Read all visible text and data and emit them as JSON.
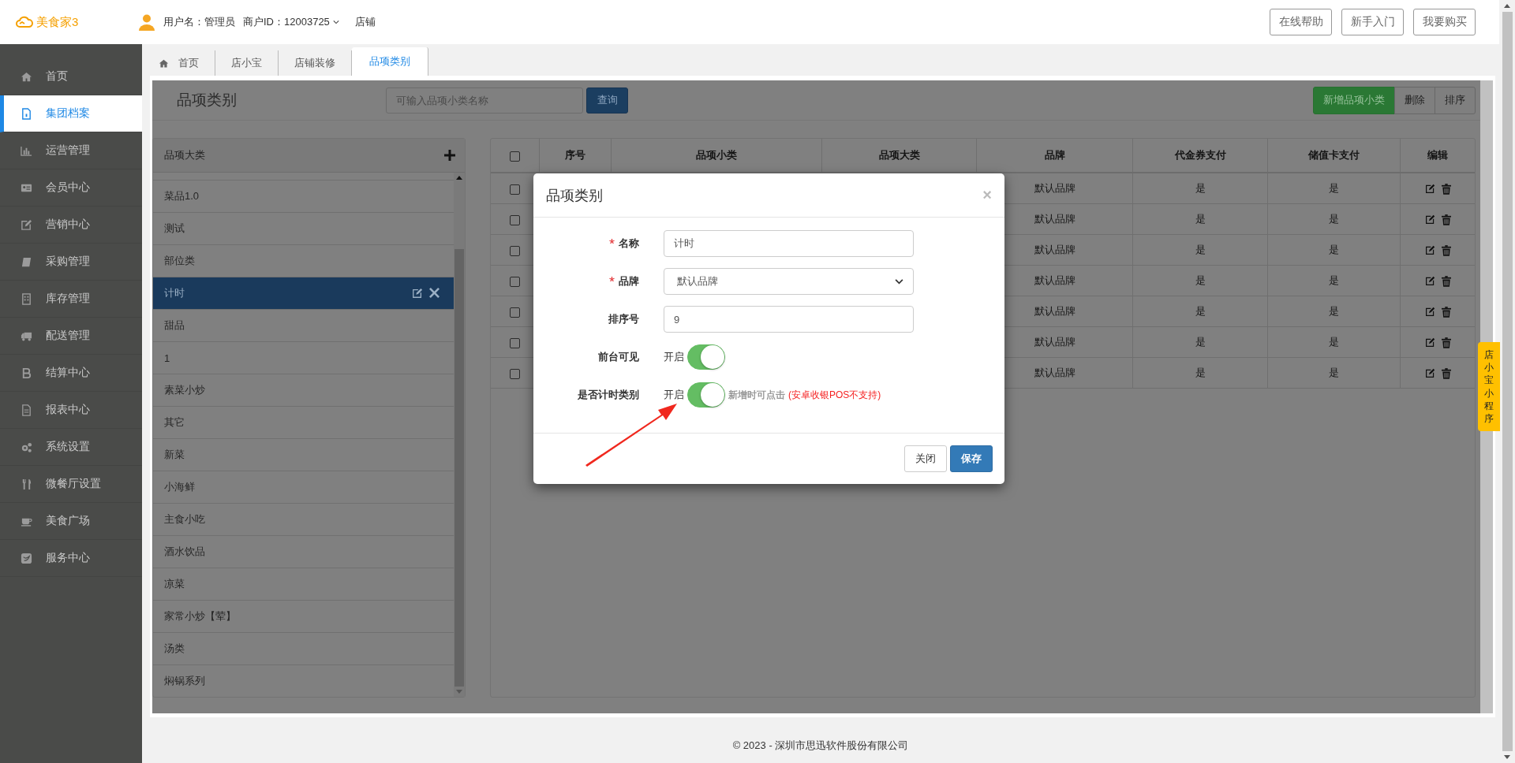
{
  "header": {
    "logo": "美食家3",
    "user": "用户名：管理员",
    "merchant": "商户ID：12003725",
    "store": "店铺",
    "buttons": [
      "在线帮助",
      "新手入门",
      "我要购买"
    ]
  },
  "sidebar": {
    "items": [
      {
        "label": "首页",
        "selected": false
      },
      {
        "label": "集团档案",
        "selected": true
      },
      {
        "label": "运营管理",
        "selected": false
      },
      {
        "label": "会员中心",
        "selected": false
      },
      {
        "label": "营销中心",
        "selected": false
      },
      {
        "label": "采购管理",
        "selected": false
      },
      {
        "label": "库存管理",
        "selected": false
      },
      {
        "label": "配送管理",
        "selected": false
      },
      {
        "label": "结算中心",
        "selected": false
      },
      {
        "label": "报表中心",
        "selected": false
      },
      {
        "label": "系统设置",
        "selected": false
      },
      {
        "label": "微餐厅设置",
        "selected": false
      },
      {
        "label": "美食广场",
        "selected": false
      },
      {
        "label": "服务中心",
        "selected": false
      }
    ]
  },
  "tabs": [
    {
      "label": "首页",
      "selected": false
    },
    {
      "label": "店小宝",
      "selected": false
    },
    {
      "label": "店铺装修",
      "selected": false
    },
    {
      "label": "品项类别",
      "selected": true
    }
  ],
  "page": {
    "title": "品项类别",
    "search": {
      "placeholder": "可输入品项小类名称"
    },
    "search_button": "查询",
    "actions": [
      {
        "label": "新增品项小类",
        "kind": "primary"
      },
      {
        "label": "删除",
        "kind": "default"
      },
      {
        "label": "排序",
        "kind": "default"
      }
    ]
  },
  "category_panel": {
    "title": "品项大类",
    "items": [
      {
        "label": "菜品1.0",
        "selected": false
      },
      {
        "label": "测试",
        "selected": false
      },
      {
        "label": "部位类",
        "selected": false
      },
      {
        "label": "计时",
        "selected": true
      },
      {
        "label": "甜品",
        "selected": false
      },
      {
        "label": "1",
        "selected": false
      },
      {
        "label": "素菜小炒",
        "selected": false
      },
      {
        "label": "其它",
        "selected": false
      },
      {
        "label": "新菜",
        "selected": false
      },
      {
        "label": "小海鲜",
        "selected": false
      },
      {
        "label": "主食小吃",
        "selected": false
      },
      {
        "label": "酒水饮品",
        "selected": false
      },
      {
        "label": "凉菜",
        "selected": false
      },
      {
        "label": "家常小炒【荤】",
        "selected": false
      },
      {
        "label": "汤类",
        "selected": false
      },
      {
        "label": "焖锅系列",
        "selected": false
      }
    ]
  },
  "table": {
    "select_all_checked": false,
    "columns": [
      "序号",
      "品项小类",
      "品项大类",
      "品牌",
      "代金券支付",
      "储值卡支付",
      "编辑"
    ],
    "rows": [
      {
        "checked": false,
        "brand": "默认品牌",
        "voucher_pay": "是",
        "stored_value_pay": "是"
      },
      {
        "checked": false,
        "brand": "默认品牌",
        "voucher_pay": "是",
        "stored_value_pay": "是"
      },
      {
        "checked": false,
        "brand": "默认品牌",
        "voucher_pay": "是",
        "stored_value_pay": "是"
      },
      {
        "checked": false,
        "brand": "默认品牌",
        "voucher_pay": "是",
        "stored_value_pay": "是"
      },
      {
        "checked": false,
        "brand": "默认品牌",
        "voucher_pay": "是",
        "stored_value_pay": "是"
      },
      {
        "checked": false,
        "brand": "默认品牌",
        "voucher_pay": "是",
        "stored_value_pay": "是"
      },
      {
        "checked": false,
        "brand": "默认品牌",
        "voucher_pay": "是",
        "stored_value_pay": "是"
      }
    ]
  },
  "modal": {
    "title": "品项类别",
    "close": "×",
    "fields": [
      {
        "kind": "text",
        "label": "名称",
        "required": true,
        "value": "计时"
      },
      {
        "kind": "select",
        "label": "品牌",
        "required": true,
        "value": "默认品牌"
      },
      {
        "kind": "text",
        "label": "排序号",
        "required": false,
        "value": "9"
      },
      {
        "kind": "switch",
        "label": "前台可见",
        "required": false,
        "on": true,
        "state_text": "开启"
      },
      {
        "kind": "switch",
        "label": "是否计时类别",
        "required": false,
        "on": true,
        "state_text": "开启",
        "hint": "新增时可点击",
        "warning": "(安卓收银POS不支持)"
      }
    ],
    "buttons": [
      {
        "label": "关闭",
        "kind": "default"
      },
      {
        "label": "保存",
        "kind": "primary"
      }
    ]
  },
  "side_tab": "店小宝小程序",
  "footer": "© 2023 - 深圳市思迅软件股份有限公司"
}
